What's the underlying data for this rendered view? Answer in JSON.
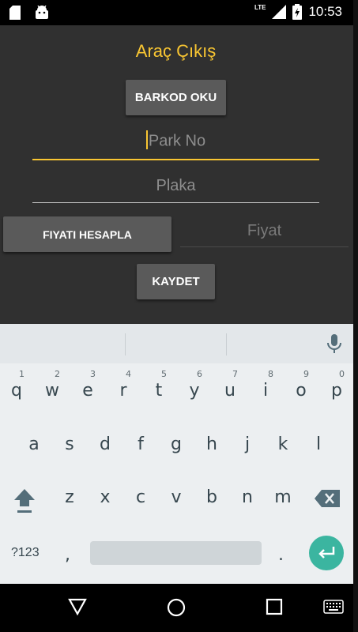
{
  "status_bar": {
    "time": "10:53",
    "network": "LTE",
    "icons": [
      "sd-card-icon",
      "android-icon",
      "signal-icon",
      "battery-charging-icon"
    ]
  },
  "app": {
    "title": "Araç Çıkış",
    "barcode_button": "BARKOD OKU",
    "park_no": {
      "placeholder": "Park No",
      "value": ""
    },
    "plate": {
      "placeholder": "Plaka",
      "value": ""
    },
    "calculate_button": "FIYATI HESAPLA",
    "price": {
      "placeholder": "Fiyat",
      "value": ""
    },
    "save_button": "KAYDET"
  },
  "keyboard": {
    "row1": [
      {
        "key": "q",
        "hint": "1"
      },
      {
        "key": "w",
        "hint": "2"
      },
      {
        "key": "e",
        "hint": "3"
      },
      {
        "key": "r",
        "hint": "4"
      },
      {
        "key": "t",
        "hint": "5"
      },
      {
        "key": "y",
        "hint": "6"
      },
      {
        "key": "u",
        "hint": "7"
      },
      {
        "key": "i",
        "hint": "8"
      },
      {
        "key": "o",
        "hint": "9"
      },
      {
        "key": "p",
        "hint": "0"
      }
    ],
    "row2": [
      "a",
      "s",
      "d",
      "f",
      "g",
      "h",
      "j",
      "k",
      "l"
    ],
    "row3": [
      "z",
      "x",
      "c",
      "v",
      "b",
      "n",
      "m"
    ],
    "symbols_key": "?123",
    "comma_key": ",",
    "period_key": "."
  },
  "colors": {
    "accent": "#f9c632",
    "app_background": "#303030",
    "button_background": "#5a5a5a",
    "keyboard_background": "#eceff1",
    "enter_key": "#3bb5a0"
  }
}
